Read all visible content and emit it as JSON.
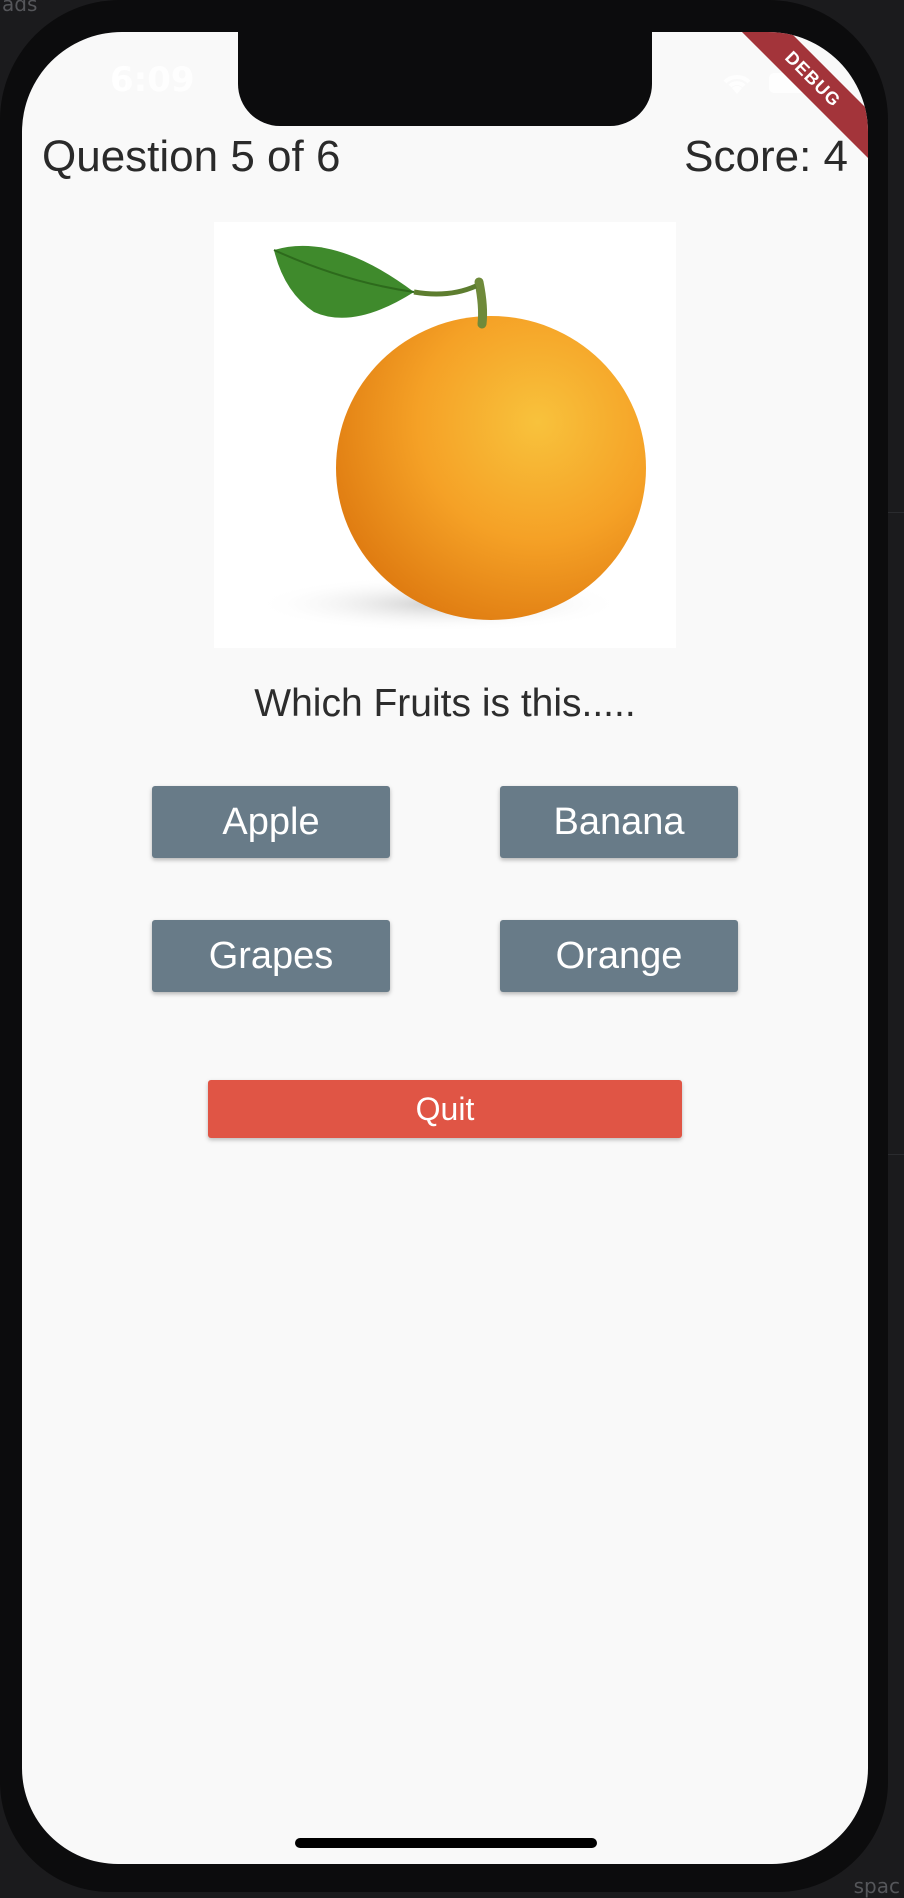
{
  "background": {
    "top_text": "ads",
    "bottom_text": "spac"
  },
  "status_bar": {
    "time": "6:09",
    "debug_label": "DEBUG"
  },
  "quiz": {
    "progress_label": "Question 5 of 6",
    "score_label": "Score: 4",
    "question_text": "Which Fruits is this.....",
    "answers": [
      "Apple",
      "Banana",
      "Grapes",
      "Orange"
    ],
    "quit_label": "Quit"
  },
  "colors": {
    "answer_button": "#687b88",
    "quit_button": "#e05545",
    "debug_banner": "#a3343a",
    "screen_bg": "#f9f9f9"
  }
}
